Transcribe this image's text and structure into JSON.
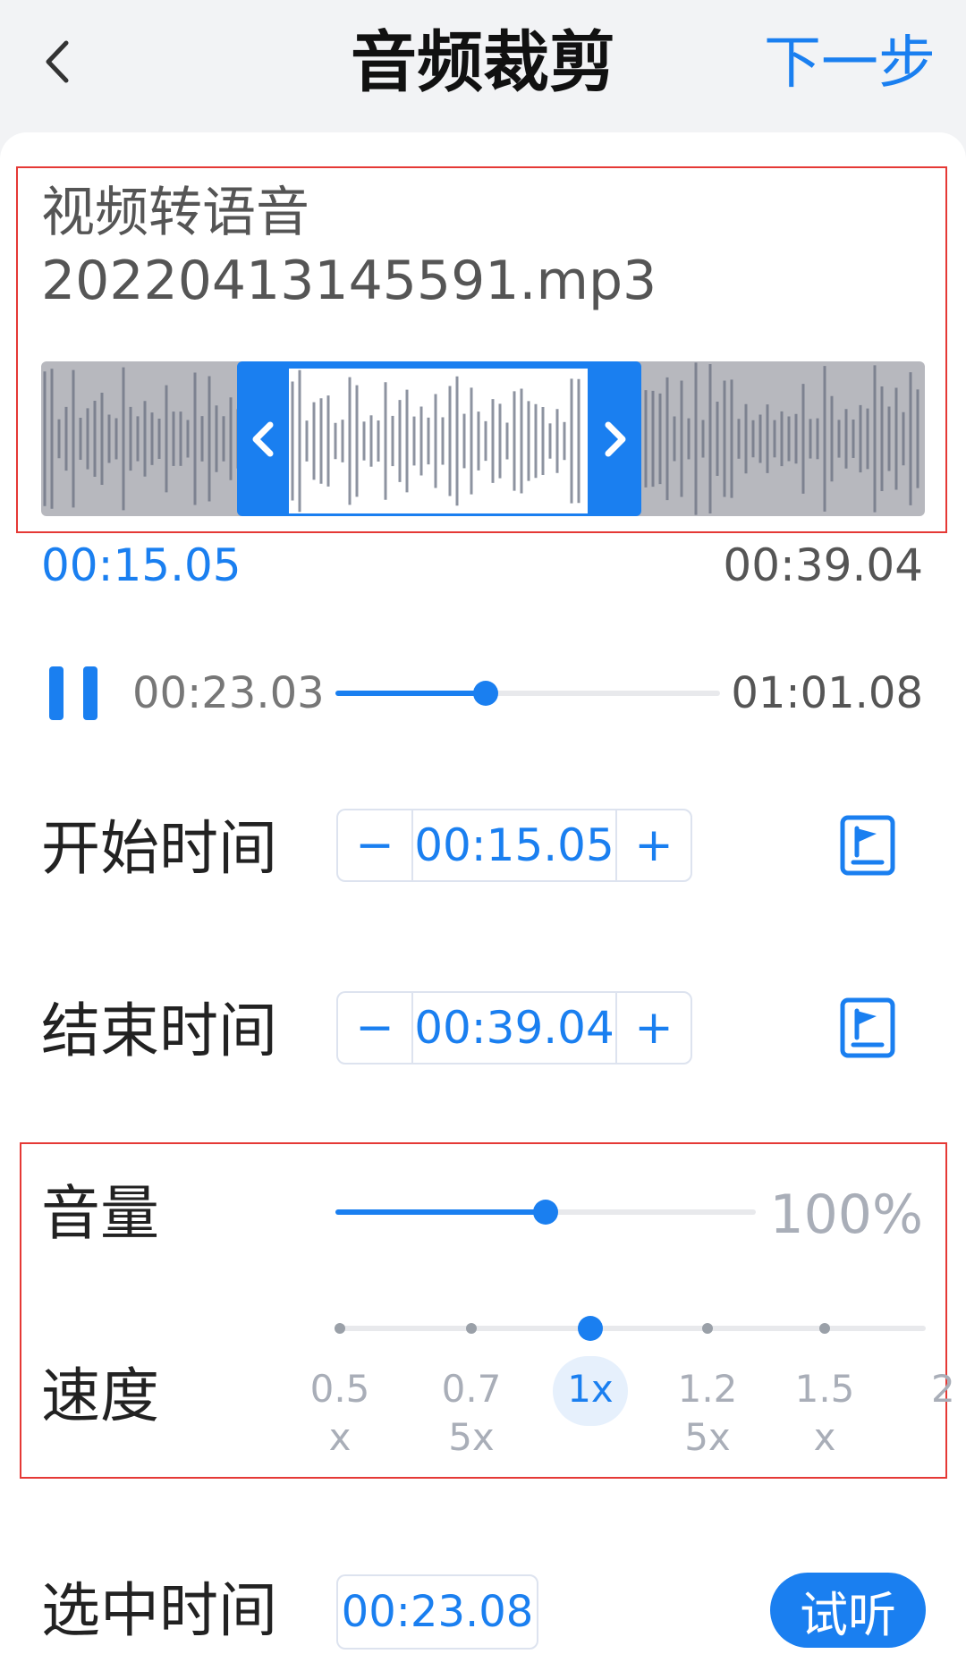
{
  "header": {
    "back_icon": "chevron-left-icon",
    "title": "音频裁剪",
    "next_label": "下一步"
  },
  "file": {
    "name_line1": "视频转语音",
    "name_line2": "20220413145591.mp3"
  },
  "waveform": {
    "left_handle_icon": "chevron-left-icon",
    "right_handle_icon": "chevron-right-icon",
    "selection_start": "00:15.05",
    "selection_end": "00:39.04"
  },
  "player": {
    "pause_icon": "pause-icon",
    "current_time": "00:23.03",
    "total_time": "01:01.08",
    "progress_fraction": 0.39
  },
  "start_time": {
    "label": "开始时间",
    "minus": "−",
    "value": "00:15.05",
    "plus": "+",
    "flag_icon": "flag-marker-icon"
  },
  "end_time": {
    "label": "结束时间",
    "minus": "−",
    "value": "00:39.04",
    "plus": "+",
    "flag_icon": "flag-marker-icon"
  },
  "volume": {
    "label": "音量",
    "value": "100%",
    "fraction": 0.5
  },
  "speed": {
    "label": "速度",
    "options": [
      {
        "line1": "0.5",
        "line2": "x"
      },
      {
        "line1": "0.7",
        "line2": "5x"
      },
      {
        "line1": "1x",
        "line2": ""
      },
      {
        "line1": "1.2",
        "line2": "5x"
      },
      {
        "line1": "1.5",
        "line2": "x"
      },
      {
        "line1": "2",
        "line2": ""
      }
    ],
    "selected_index": 2
  },
  "selected": {
    "label": "选中时间",
    "value": "00:23.08",
    "listen_label": "试听"
  },
  "colors": {
    "accent": "#1a7ff0",
    "highlight_border": "#e53935"
  }
}
